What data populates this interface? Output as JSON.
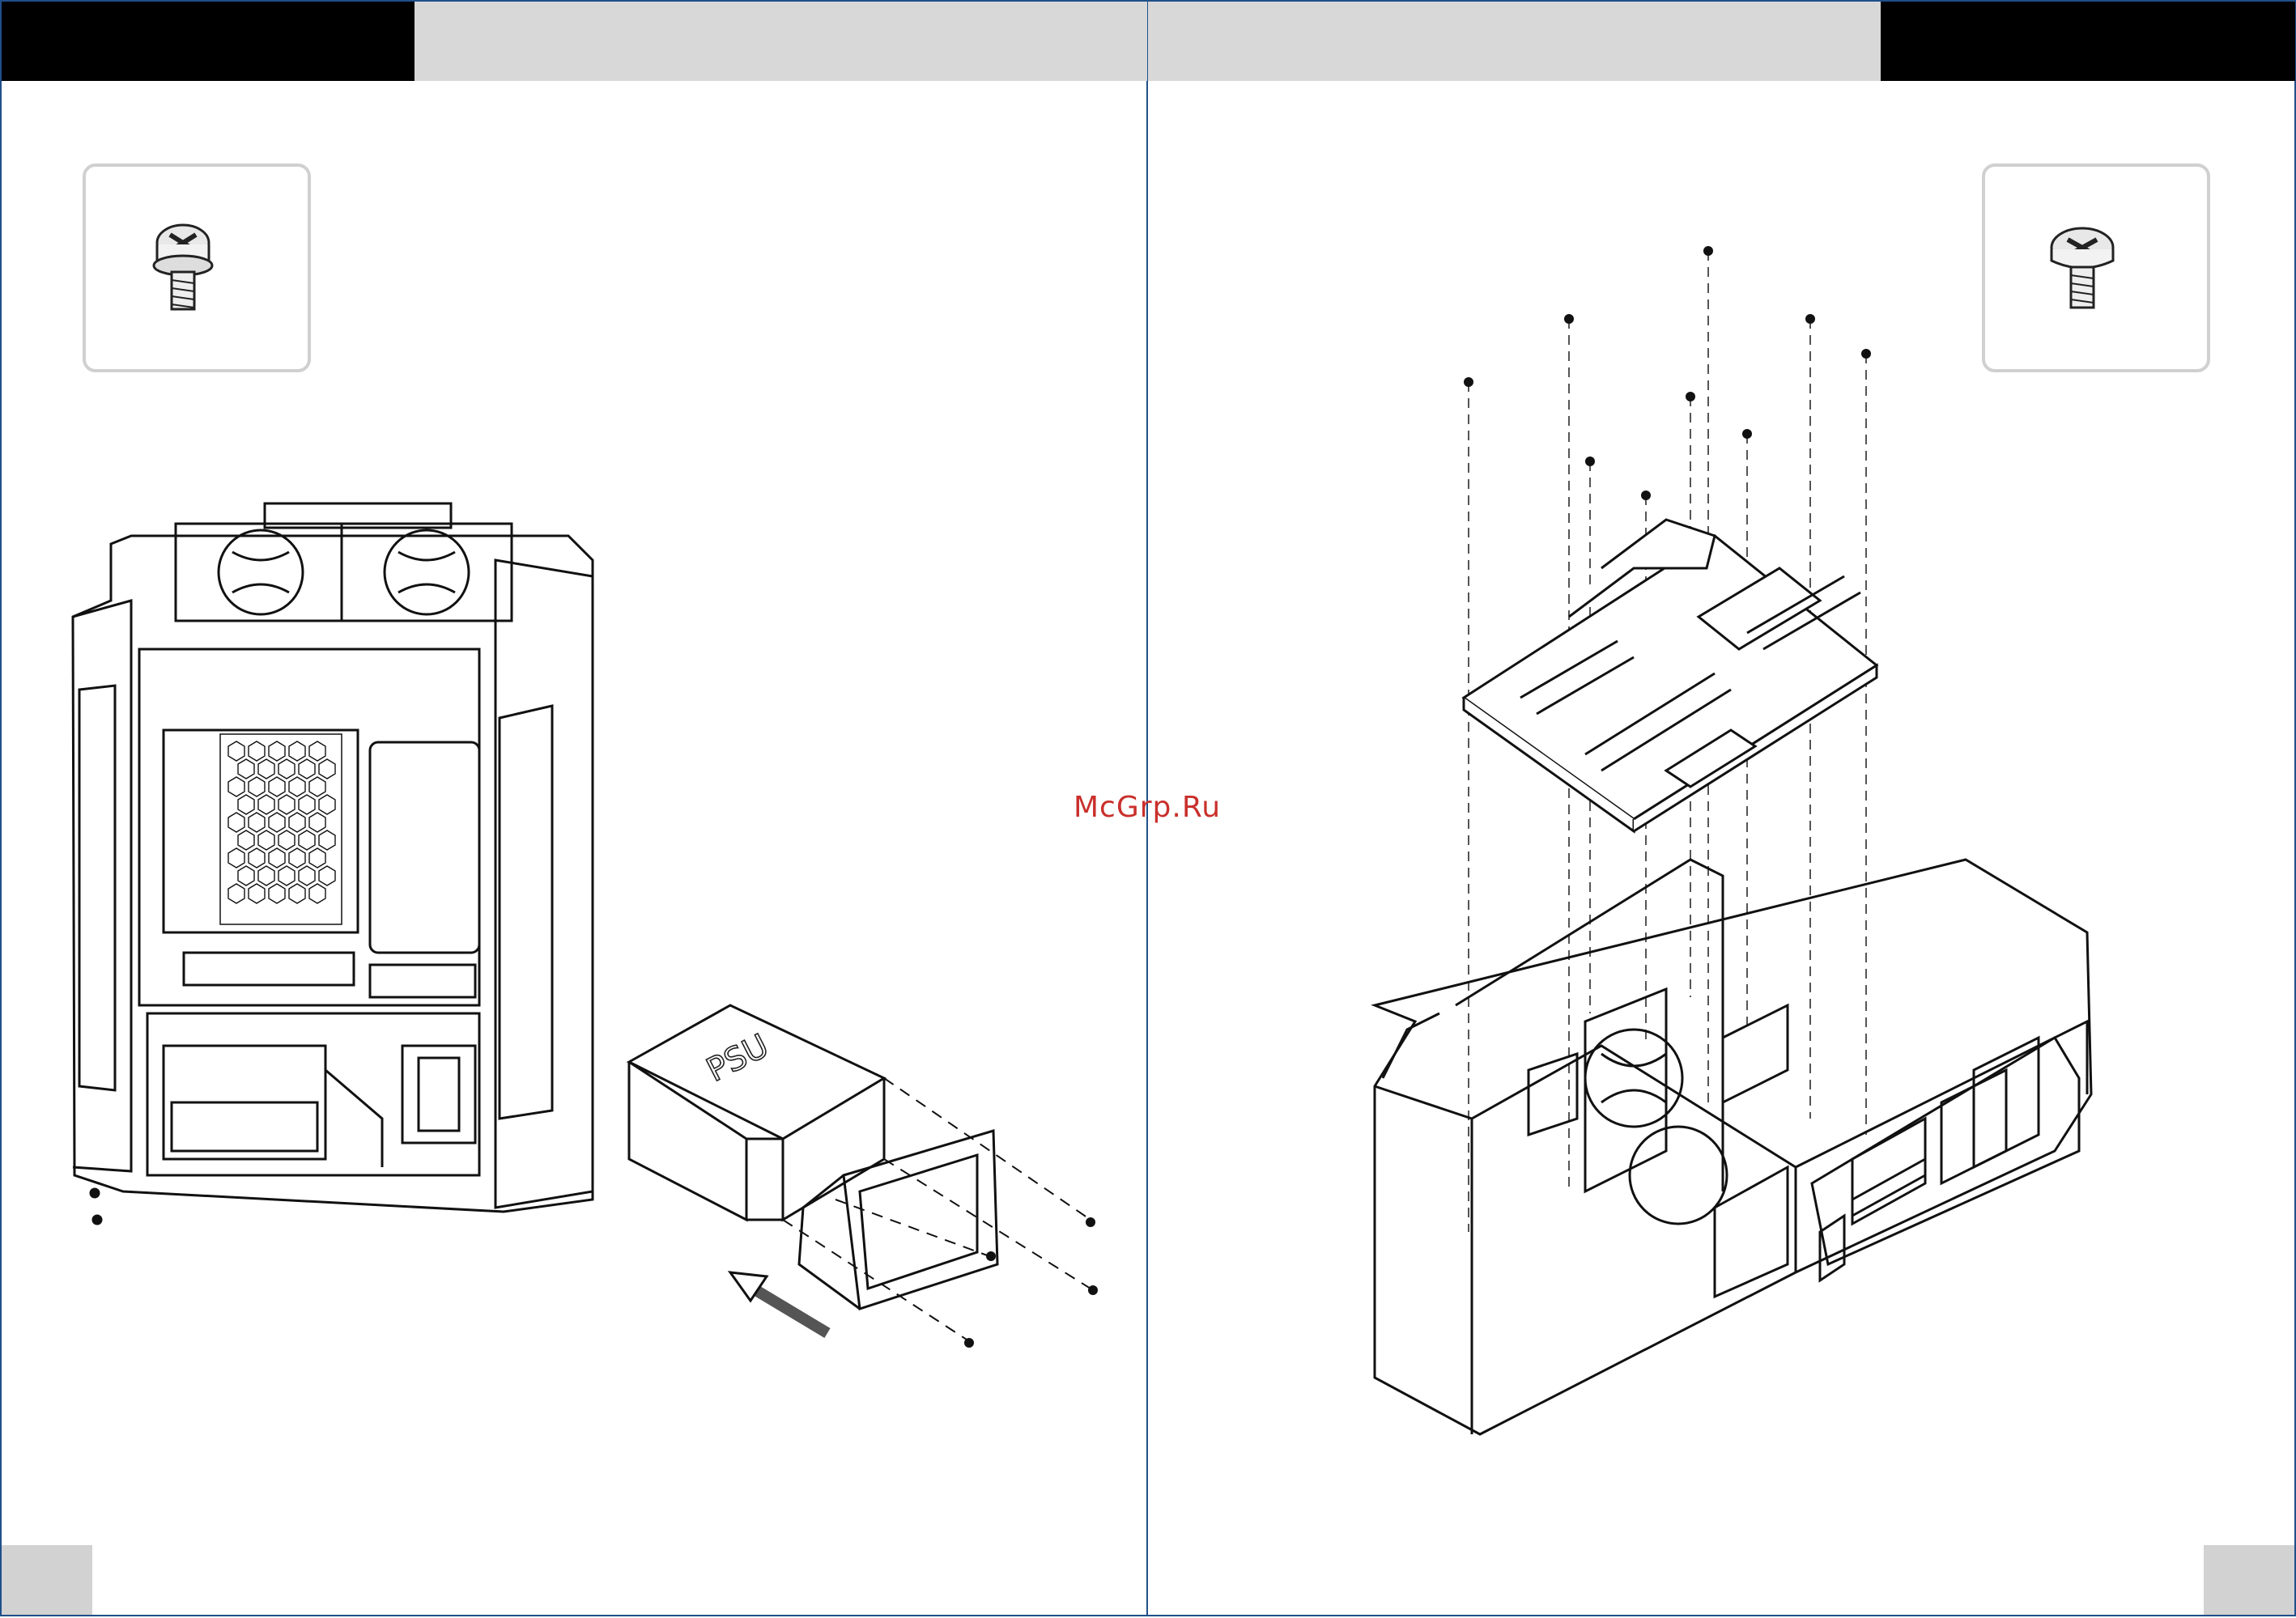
{
  "header": {
    "left_tab": "",
    "right_tab": ""
  },
  "watermark": {
    "text": "McGrp.Ru"
  },
  "psu": {
    "label": "PSU"
  },
  "colors": {
    "border": "#1f4f8a",
    "band": "#000000",
    "band_gray": "#d8d8d8",
    "footer_tab": "#d2d2d2",
    "watermark": "#c9302c"
  },
  "icons": {
    "left_screw": "screw-with-washer-icon",
    "right_screw": "motherboard-screw-icon"
  }
}
